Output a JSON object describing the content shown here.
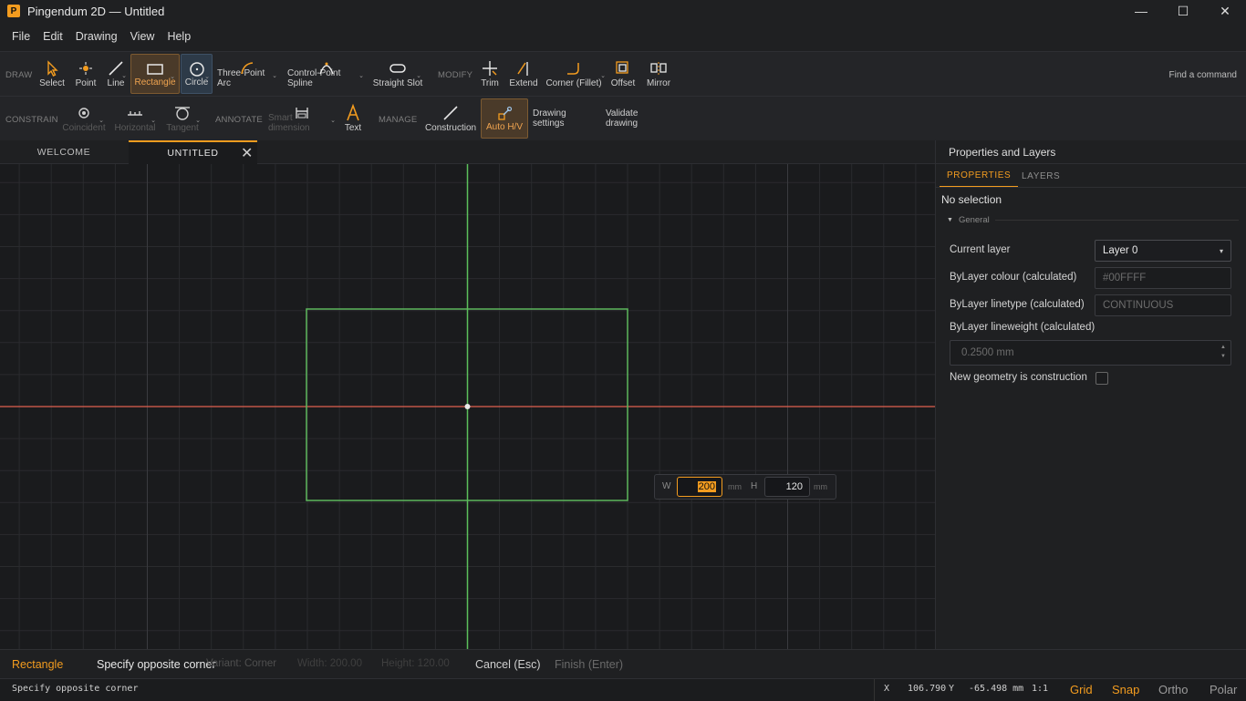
{
  "window": {
    "title": "Pingendum 2D — Untitled",
    "logo_letter": "P",
    "minimize": "—",
    "maximize": "☐",
    "close": "✕"
  },
  "menu": [
    "File",
    "Edit",
    "Drawing",
    "View",
    "Help"
  ],
  "toolbar1": {
    "draw_label": "DRAW",
    "modify_label": "MODIFY",
    "tools": {
      "select": "Select",
      "point": "Point",
      "line": "Line",
      "rectangle": "Rectangle",
      "circle": "Circle",
      "arc": "Three-Point Arc",
      "spline": "Control-Point Spline",
      "slot": "Straight Slot",
      "trim": "Trim",
      "extend": "Extend",
      "fillet": "Corner (Fillet)",
      "offset": "Offset",
      "mirror": "Mirror"
    },
    "find_command": "Find a command"
  },
  "toolbar2": {
    "constrain_label": "CONSTRAIN",
    "annotate_label": "ANNOTATE",
    "manage_label": "MANAGE",
    "tools": {
      "coincident": "Coincident",
      "horizontal": "Horizontal",
      "tangent": "Tangent",
      "smart_dimension": "Smart dimension",
      "text": "Text",
      "construction": "Construction",
      "auto_hv": "Auto H/V",
      "drawing_settings": "Drawing settings",
      "validate": "Validate drawing"
    }
  },
  "tabs": [
    {
      "label": "WELCOME"
    },
    {
      "label": "UNTITLED",
      "close": "✕"
    }
  ],
  "dimension_input": {
    "w_label": "W",
    "w_value": "200",
    "w_unit": "mm",
    "h_label": "H",
    "h_value": "120",
    "h_unit": "mm"
  },
  "panel": {
    "title": "Properties and Layers",
    "tab_properties": "PROPERTIES",
    "tab_layers": "LAYERS",
    "no_selection": "No selection",
    "general": "General",
    "current_layer_label": "Current layer",
    "current_layer_value": "Layer 0",
    "colour_label": "ByLayer colour (calculated)",
    "colour_value": "#00FFFF",
    "linetype_label": "ByLayer linetype (calculated)",
    "linetype_value": "CONTINUOUS",
    "lineweight_label": "ByLayer lineweight (calculated)",
    "lineweight_value": "0.2500 mm",
    "construction_label": "New geometry is construction"
  },
  "command_bar": {
    "tool": "Rectangle",
    "prompt": "Specify opposite corner",
    "variant": "Variant: Corner",
    "width": "Width: 200.00",
    "height": "Height: 120.00",
    "cancel": "Cancel (Esc)",
    "finish": "Finish (Enter)"
  },
  "status": {
    "message": "Specify opposite corner",
    "x_label": "X",
    "x_value": "106.790",
    "y_label": "Y",
    "y_value": "-65.498 mm",
    "scale": "1:1",
    "grid": "Grid",
    "snap": "Snap",
    "ortho": "Ortho",
    "polar": "Polar"
  },
  "colors": {
    "accent": "#f39c1f",
    "x_axis": "#e06050",
    "y_axis": "#5cc05c",
    "rect": "#5cb85c"
  }
}
